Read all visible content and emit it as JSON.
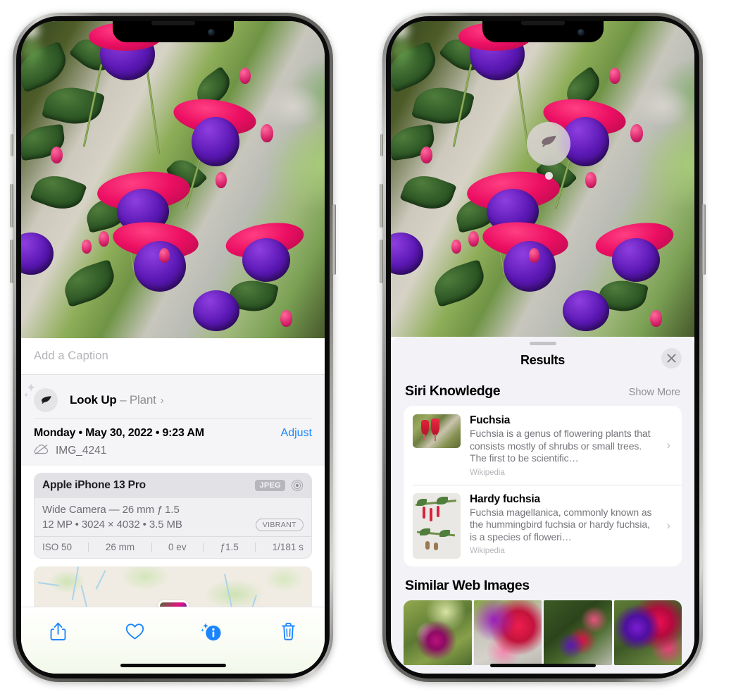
{
  "left_phone": {
    "name": "photos-detail-screen",
    "caption": {
      "placeholder": "Add a Caption",
      "value": ""
    },
    "lookup": {
      "icon": "leaf-icon",
      "label": "Look Up",
      "separator": " – ",
      "subject": "Plant",
      "chevron": "›"
    },
    "metadata": {
      "date_line": "Monday • May 30, 2022 • 9:23 AM",
      "adjust_label": "Adjust",
      "cloud_icon": "icloud-slash-icon",
      "filename": "IMG_4241"
    },
    "camera_card": {
      "model": "Apple iPhone 13 Pro",
      "format_badge": "JPEG",
      "raw_icon": "raw-circle-icon",
      "lens_line": "Wide Camera — 26 mm ƒ 1.5",
      "size_line": "12 MP • 3024 × 4032 • 3.5 MB",
      "style_badge": "VIBRANT",
      "exif": [
        "ISO 50",
        "26 mm",
        "0 ev",
        "ƒ1.5",
        "1/181 s"
      ]
    },
    "map": {
      "thumb_label": "photo-location-thumbnail"
    },
    "toolbar": [
      {
        "name": "share-button",
        "icon": "share-icon"
      },
      {
        "name": "favorite-button",
        "icon": "heart-icon"
      },
      {
        "name": "info-button",
        "icon": "info-sparkle-icon"
      },
      {
        "name": "delete-button",
        "icon": "trash-icon"
      }
    ]
  },
  "right_phone": {
    "name": "visual-lookup-results-screen",
    "bubble": {
      "icon": "leaf-icon",
      "tooltip": "Look Up subject indicator"
    },
    "sheet": {
      "title": "Results",
      "close_icon": "close-icon",
      "sections": [
        {
          "title": "Siri Knowledge",
          "action_label": "Show More",
          "items": [
            {
              "title": "Fuchsia",
              "description": "Fuchsia is a genus of flowering plants that consists mostly of shrubs or small trees. The first to be scientific…",
              "source": "Wikipedia",
              "thumb": "fuchsia-thumbnail",
              "chevron": "›"
            },
            {
              "title": "Hardy fuchsia",
              "description": "Fuchsia magellanica, commonly known as the hummingbird fuchsia or hardy fuchsia, is a species of floweri…",
              "source": "Wikipedia",
              "thumb": "hardy-fuchsia-thumbnail",
              "chevron": "›"
            }
          ]
        },
        {
          "title": "Similar Web Images",
          "images": [
            "similar-image-1",
            "similar-image-2",
            "similar-image-3",
            "similar-image-4"
          ]
        }
      ]
    }
  },
  "colors": {
    "accent_blue": "#1a84ff",
    "sheet_gray": "#f2f2f7",
    "card_white": "#ffffff",
    "secondary_text": "#8e8e93",
    "badge_gray": "#b6b6bc"
  }
}
